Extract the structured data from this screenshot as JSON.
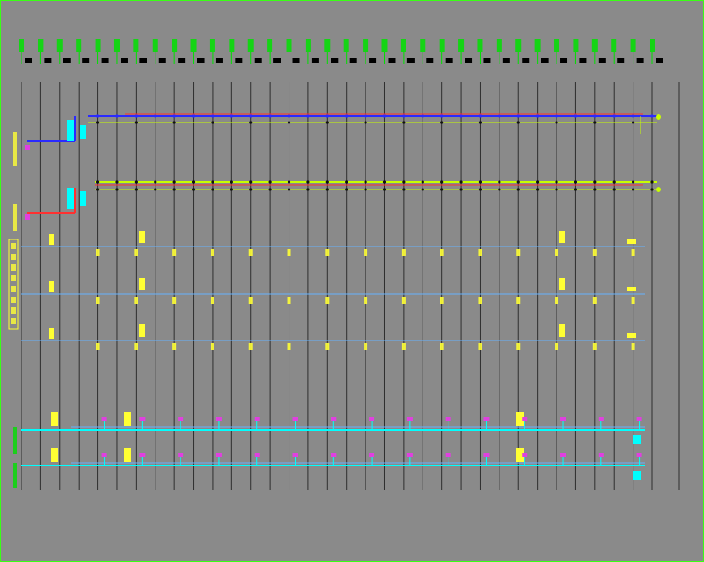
{
  "colors": {
    "background": "#8a8a8a",
    "frame": "#39ff14",
    "grid_line": "#2e2e2e",
    "column_tag": "#00e000",
    "label_yellow": "#ffff33",
    "pipe_blue": "#2a2aff",
    "pipe_red": "#ff3030",
    "pipe_light_blue": "#66b3ff",
    "pipe_cyan": "#00ffff",
    "pipe_yellow_green": "#c8ff00",
    "equipment_magenta": "#e040e0",
    "node_dark": "#111111"
  },
  "drawing": {
    "columns": 34,
    "system_rows": [
      {
        "id": "supply-main",
        "style": "blue-red"
      },
      {
        "id": "return-main",
        "style": "yellow-red"
      },
      {
        "id": "branch-1",
        "style": "light-blue"
      },
      {
        "id": "branch-2",
        "style": "light-blue"
      },
      {
        "id": "branch-3",
        "style": "light-blue"
      },
      {
        "id": "terminal-1",
        "style": "cyan"
      },
      {
        "id": "terminal-2",
        "style": "cyan"
      }
    ],
    "icons": [
      "pump-icon",
      "valve-icon",
      "riser-icon",
      "fan-coil-icon"
    ]
  }
}
